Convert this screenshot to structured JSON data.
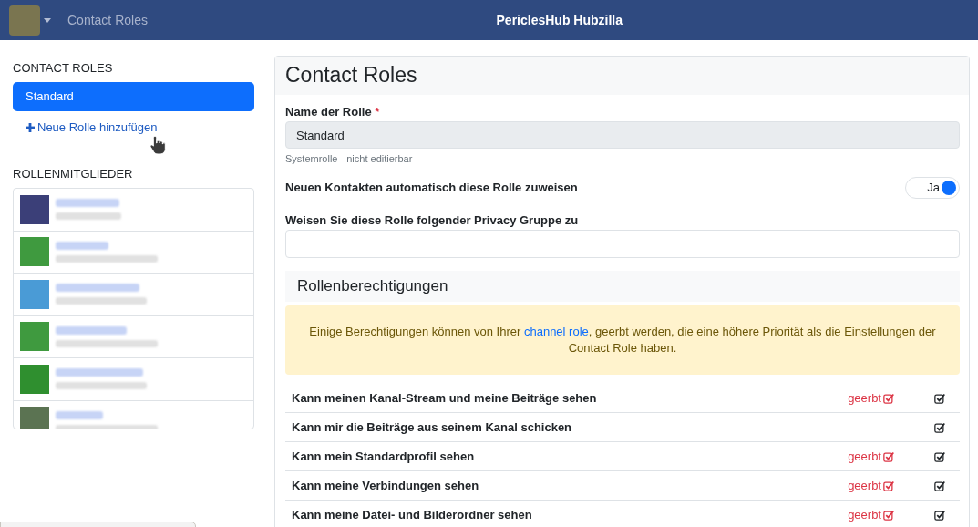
{
  "topbar": {
    "page_title": "Contact Roles",
    "site_name": "PericlesHub Hubzilla"
  },
  "sidebar": {
    "roles_heading": "CONTACT ROLES",
    "roles": [
      {
        "label": "Standard",
        "selected": true
      }
    ],
    "add_role_link": "Neue Rolle hinzufügen",
    "members_heading": "ROLLENMITGLIEDER",
    "members": [
      {
        "color": "#3b3f78"
      },
      {
        "color": "#3f9a3f"
      },
      {
        "color": "#4a9bd6"
      },
      {
        "color": "#3f9a3f"
      },
      {
        "color": "#2f8f2f"
      },
      {
        "color": "#5b7352"
      }
    ]
  },
  "main": {
    "title": "Contact Roles",
    "role_name": {
      "label": "Name der Rolle",
      "required_mark": "*",
      "value": "Standard",
      "disabled": true,
      "help": "Systemrolle - nicht editierbar"
    },
    "auto_assign": {
      "label": "Neuen Kontakten automatisch diese Rolle zuweisen",
      "value_text": "Ja",
      "on": true
    },
    "privacy_group": {
      "label": "Weisen Sie diese Rolle folgender Privacy Gruppe zu"
    },
    "permissions_heading": "Rollenberechtigungen",
    "notice": {
      "before": "Einige Berechtigungen können von Ihrer ",
      "link": "channel role",
      "after": ", geerbt werden, die eine höhere Priorität als die Einstellungen der Contact Role haben."
    },
    "permissions": [
      {
        "label": "Kann meinen Kanal-Stream und meine Beiträge sehen",
        "inherited_note": "geerbt",
        "checked": true
      },
      {
        "label": "Kann mir die Beiträge aus seinem Kanal schicken",
        "checked": true
      },
      {
        "label": "Kann mein Standardprofil sehen",
        "inherited_note": "geerbt",
        "checked": true
      },
      {
        "label": "Kann meine Verbindungen sehen",
        "inherited_note": "geerbt",
        "checked": true
      },
      {
        "label": "Kann meine Datei- und Bilderordner sehen",
        "inherited_note": "geerbt",
        "checked": true
      }
    ]
  }
}
